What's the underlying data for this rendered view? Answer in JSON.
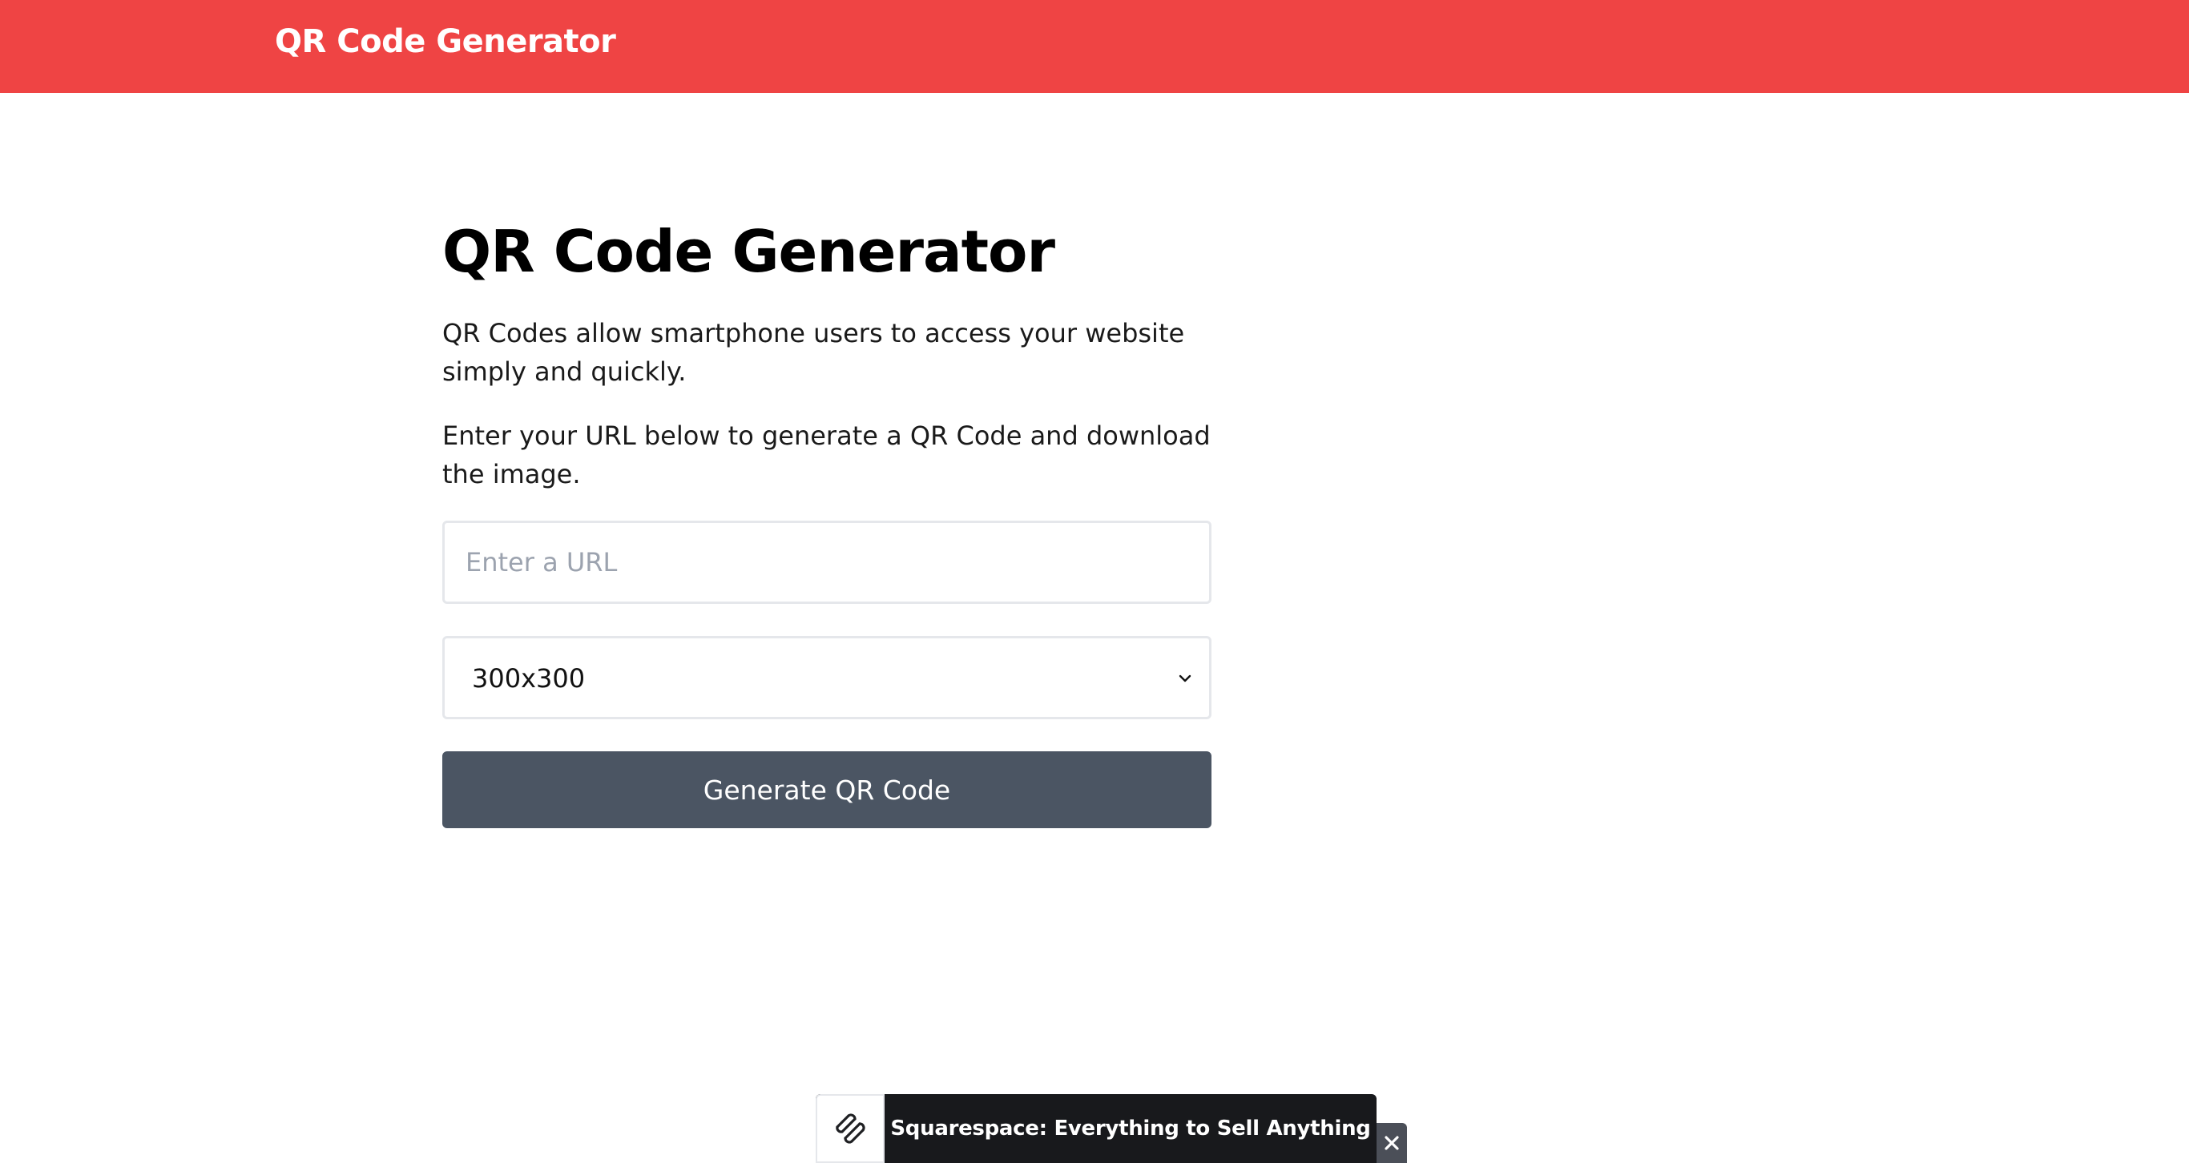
{
  "header": {
    "brand": "QR Code Generator",
    "background_color": "#ef4444"
  },
  "main": {
    "title": "QR Code Generator",
    "paragraph_1": "QR Codes allow smartphone users to access your website simply and quickly.",
    "paragraph_2": "Enter your URL below to generate a QR Code and download the image.",
    "url_input": {
      "value": "",
      "placeholder": "Enter a URL"
    },
    "size_select": {
      "selected": "300x300",
      "icon": "chevron-down-icon"
    },
    "generate_button": {
      "label": "Generate QR Code",
      "color": "#4b5563"
    }
  },
  "ad": {
    "text": "Squarespace: Everything to Sell Anything",
    "logo_icon": "squarespace-logo",
    "close_icon": "close-icon"
  }
}
